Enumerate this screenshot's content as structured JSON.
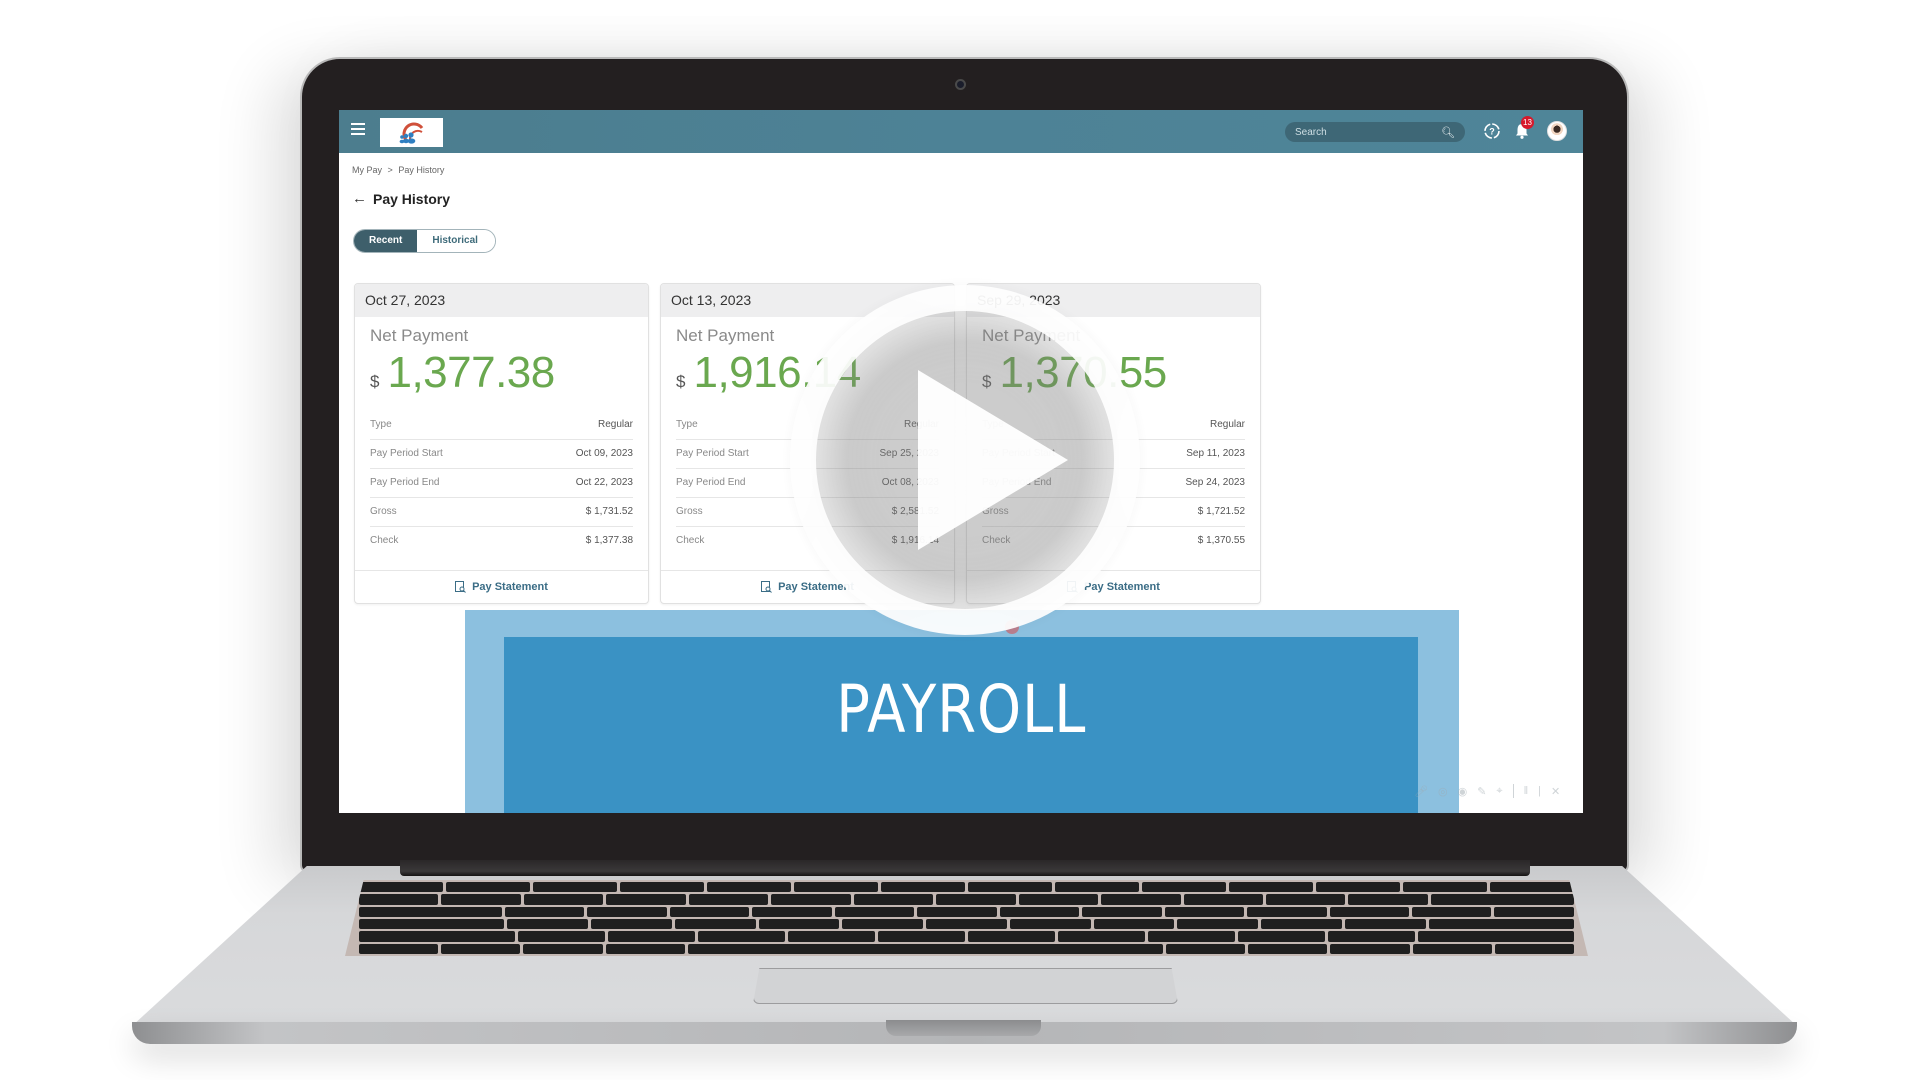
{
  "header": {
    "menu_icon": "hamburger-icon",
    "logo": "company-logo",
    "search_placeholder": "Search",
    "search_icon": "search-icon",
    "help_icon": "help-icon",
    "notifications_icon": "bell-icon",
    "notification_count": "13",
    "avatar": "user-avatar"
  },
  "breadcrumb": [
    "My Pay",
    ">",
    "Pay History"
  ],
  "page": {
    "back_icon": "arrow-left-icon",
    "title": "Pay History"
  },
  "tabs": [
    {
      "label": "Recent",
      "active": true
    },
    {
      "label": "Historical",
      "active": false
    }
  ],
  "cards": [
    {
      "date": "Oct 27, 2023",
      "net_label": "Net Payment",
      "currency": "$",
      "net_value": "1,377.38",
      "rows": [
        {
          "label": "Type",
          "value": "Regular"
        },
        {
          "label": "Pay Period Start",
          "value": "Oct 09, 2023"
        },
        {
          "label": "Pay Period End",
          "value": "Oct 22, 2023"
        },
        {
          "label": "Gross",
          "value": "$ 1,731.52"
        },
        {
          "label": "Check",
          "value": "$ 1,377.38"
        }
      ],
      "footer_label": "Pay Statement"
    },
    {
      "date": "Oct 13, 2023",
      "net_label": "Net Payment",
      "currency": "$",
      "net_value": "1,916.14",
      "rows": [
        {
          "label": "Type",
          "value": "Regular"
        },
        {
          "label": "Pay Period Start",
          "value": "Sep 25, 2023"
        },
        {
          "label": "Pay Period End",
          "value": "Oct 08, 2023"
        },
        {
          "label": "Gross",
          "value": "$ 2,581.52"
        },
        {
          "label": "Check",
          "value": "$ 1,916.14"
        }
      ],
      "footer_label": "Pay Statement"
    },
    {
      "date": "Sep 29, 2023",
      "net_label": "Net Payment",
      "currency": "$",
      "net_value": "1,370.55",
      "rows": [
        {
          "label": "Type",
          "value": "Regular"
        },
        {
          "label": "Pay Period Start",
          "value": "Sep 11, 2023"
        },
        {
          "label": "Pay Period End",
          "value": "Sep 24, 2023"
        },
        {
          "label": "Gross",
          "value": "$ 1,721.52"
        },
        {
          "label": "Check",
          "value": "$ 1,370.55"
        }
      ],
      "footer_label": "Pay Statement"
    }
  ],
  "banner": {
    "title": "PAYROLL"
  },
  "recording_toolbar": {
    "icons": [
      "mic-icon",
      "camera-icon",
      "webcam-icon",
      "pencil-icon",
      "cursor-icon",
      "pause-icon",
      "stop-icon",
      "close-icon"
    ]
  },
  "video": {
    "play_icon": "play-icon"
  },
  "colors": {
    "header_bg": "#4d8296",
    "net_amount": "#6aa84f",
    "tab_active": "#3e5f6b",
    "link": "#3b6d86",
    "banner_outer": "#8cc0df",
    "banner_inner": "#3a92c4",
    "badge": "#d7192b"
  }
}
